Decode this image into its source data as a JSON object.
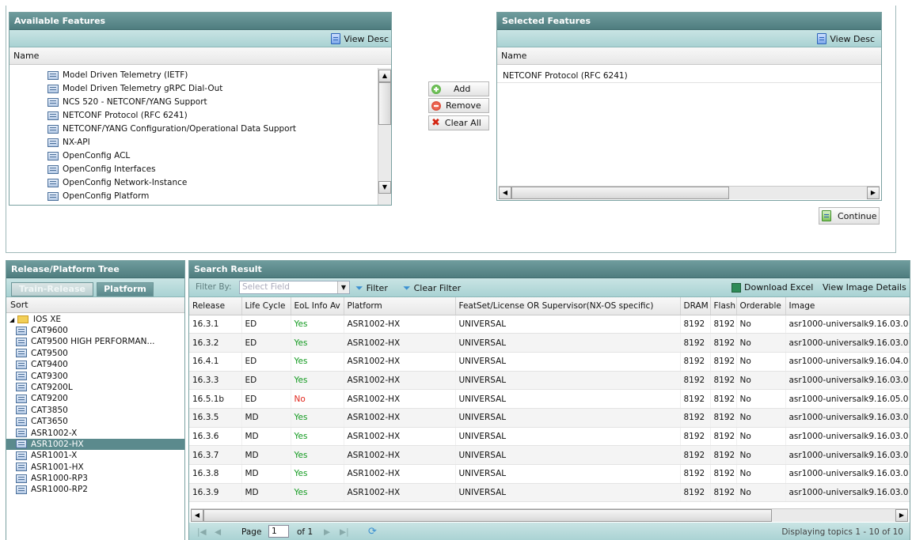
{
  "available": {
    "title": "Available Features",
    "view_desc": "View Desc",
    "col_name": "Name",
    "items": [
      "Model Driven Telemetry (IETF)",
      "Model Driven Telemetry gRPC Dial-Out",
      "NCS 520 - NETCONF/YANG Support",
      "NETCONF Protocol (RFC 6241)",
      "NETCONF/YANG Configuration/Operational Data Support",
      "NX-API",
      "OpenConfig ACL",
      "OpenConfig Interfaces",
      "OpenConfig Network-Instance",
      "OpenConfig Platform"
    ]
  },
  "actions": {
    "add": "Add",
    "remove": "Remove",
    "clear_all": "Clear All"
  },
  "selected": {
    "title": "Selected Features",
    "view_desc": "View Desc",
    "col_name": "Name",
    "items": [
      "NETCONF Protocol (RFC 6241)"
    ],
    "continue": "Continue"
  },
  "tree": {
    "title": "Release/Platform Tree",
    "tabs": [
      "Train-Release",
      "Platform"
    ],
    "sort": "Sort",
    "root": "IOS XE",
    "items": [
      "CAT9600",
      "CAT9500 HIGH PERFORMAN...",
      "CAT9500",
      "CAT9400",
      "CAT9300",
      "CAT9200L",
      "CAT9200",
      "CAT3850",
      "CAT3650",
      "ASR1002-X",
      "ASR1002-HX",
      "ASR1001-X",
      "ASR1001-HX",
      "ASR1000-RP3",
      "ASR1000-RP2"
    ],
    "selected_item": "ASR1002-HX"
  },
  "search": {
    "title": "Search Result",
    "filter_by": "Filter By:",
    "filter_placeholder": "Select Field",
    "filter_btn": "Filter",
    "clear_filter": "Clear Filter",
    "download_excel": "Download Excel",
    "view_image_details": "View Image Details",
    "columns": [
      "Release",
      "Life Cycle",
      "EoL Info Av",
      "Platform",
      "FeatSet/License OR Supervisor(NX-OS specific)",
      "DRAM",
      "Flash",
      "Orderable",
      "Image"
    ],
    "rows": [
      [
        "16.3.1",
        "ED",
        "Yes",
        "ASR1002-HX",
        "UNIVERSAL",
        "8192",
        "8192",
        "No",
        "asr1000-universalk9.16.03.0"
      ],
      [
        "16.3.2",
        "ED",
        "Yes",
        "ASR1002-HX",
        "UNIVERSAL",
        "8192",
        "8192",
        "No",
        "asr1000-universalk9.16.03.0"
      ],
      [
        "16.4.1",
        "ED",
        "Yes",
        "ASR1002-HX",
        "UNIVERSAL",
        "8192",
        "8192",
        "No",
        "asr1000-universalk9.16.04.0"
      ],
      [
        "16.3.3",
        "ED",
        "Yes",
        "ASR1002-HX",
        "UNIVERSAL",
        "8192",
        "8192",
        "No",
        "asr1000-universalk9.16.03.0"
      ],
      [
        "16.5.1b",
        "ED",
        "No",
        "ASR1002-HX",
        "UNIVERSAL",
        "8192",
        "8192",
        "No",
        "asr1000-universalk9.16.05.0"
      ],
      [
        "16.3.5",
        "MD",
        "Yes",
        "ASR1002-HX",
        "UNIVERSAL",
        "8192",
        "8192",
        "No",
        "asr1000-universalk9.16.03.0"
      ],
      [
        "16.3.6",
        "MD",
        "Yes",
        "ASR1002-HX",
        "UNIVERSAL",
        "8192",
        "8192",
        "No",
        "asr1000-universalk9.16.03.0"
      ],
      [
        "16.3.7",
        "MD",
        "Yes",
        "ASR1002-HX",
        "UNIVERSAL",
        "8192",
        "8192",
        "No",
        "asr1000-universalk9.16.03.0"
      ],
      [
        "16.3.8",
        "MD",
        "Yes",
        "ASR1002-HX",
        "UNIVERSAL",
        "8192",
        "8192",
        "No",
        "asr1000-universalk9.16.03.0"
      ],
      [
        "16.3.9",
        "MD",
        "Yes",
        "ASR1002-HX",
        "UNIVERSAL",
        "8192",
        "8192",
        "No",
        "asr1000-universalk9.16.03.0"
      ]
    ],
    "page_label": "Page",
    "page_value": "1",
    "of_label": "of 1",
    "displaying": "Displaying topics 1 - 10 of 10"
  },
  "colors": {
    "header": "#5f8d8f",
    "toolbar": "#b8dbdc",
    "yes": "#129a1f",
    "no": "#e1261c"
  }
}
